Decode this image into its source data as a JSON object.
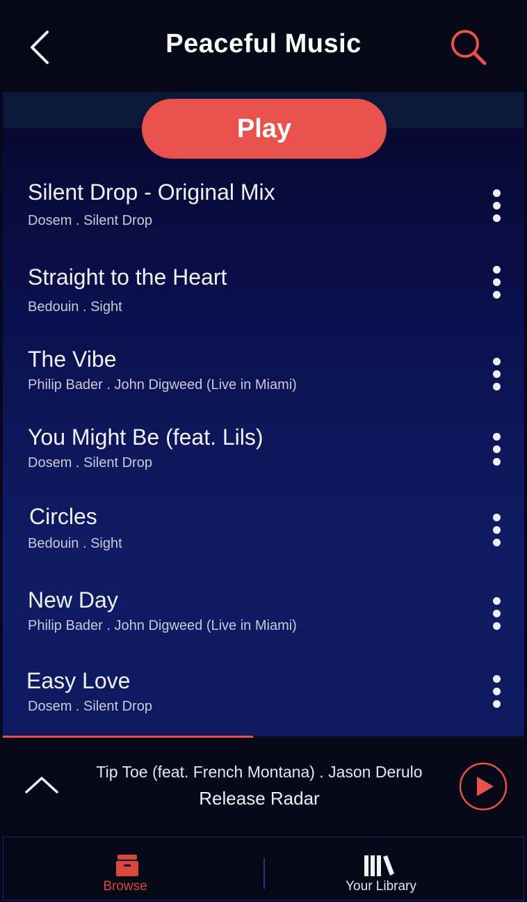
{
  "header": {
    "title": "Peaceful Music",
    "back_icon": "chevron-left-icon",
    "search_icon": "search-icon"
  },
  "play_button": {
    "label": "Play"
  },
  "tracks": [
    {
      "title": "Silent Drop - Original Mix",
      "subtitle": "Dosem . Silent Drop"
    },
    {
      "title": "Straight to the Heart",
      "subtitle": "Bedouin . Sight"
    },
    {
      "title": "The Vibe",
      "subtitle": "Philip Bader . John Digweed (Live in Miami)"
    },
    {
      "title": "You Might Be (feat. Lils)",
      "subtitle": "Dosem . Silent Drop"
    },
    {
      "title": "Circles",
      "subtitle": "Bedouin . Sight"
    },
    {
      "title": "New Day",
      "subtitle": "Philip Bader . John Digweed (Live in Miami)"
    },
    {
      "title": "Easy Love",
      "subtitle": "Dosem . Silent Drop"
    }
  ],
  "now_playing": {
    "track": "Tip Toe (feat. French Montana) . Jason Derulo",
    "source": "Release Radar",
    "progress": 0.48
  },
  "tabs": [
    {
      "label": "Browse",
      "icon": "archive-box-icon",
      "active": true
    },
    {
      "label": "Your Library",
      "icon": "library-books-icon",
      "active": false
    }
  ],
  "colors": {
    "accent": "#e8514c",
    "background": "#07081e",
    "list_gradient_end": "#0f1b63"
  }
}
